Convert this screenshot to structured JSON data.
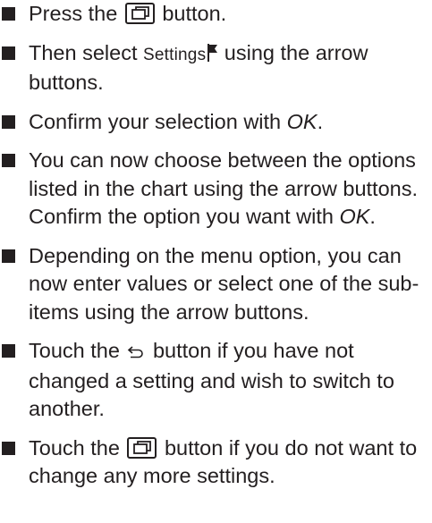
{
  "steps": [
    {
      "before": "Press the ",
      "after": " button."
    },
    {
      "before": "Then select ",
      "settings": "Settings",
      "after": " using the arrow buttons."
    },
    {
      "before": "Confirm your selection with ",
      "em": "OK",
      "after": "."
    },
    {
      "line1": "You can now choose between the options listed in the chart using the arrow buttons.",
      "line2_before": "Confirm the option you want with ",
      "line2_em": "OK",
      "line2_after": "."
    },
    {
      "text": "Depending on the menu option, you can now enter values or select one of the sub-items using the arrow buttons."
    },
    {
      "before": "Touch the ",
      "after": " button if you have not changed a setting and wish to switch to another."
    },
    {
      "before": "Touch the ",
      "after": " button if you do not want to change any more settings."
    }
  ],
  "icons": {
    "menu_button": "menu-button-icon",
    "settings_flag": "flag-icon",
    "back": "back-arrow-icon"
  }
}
